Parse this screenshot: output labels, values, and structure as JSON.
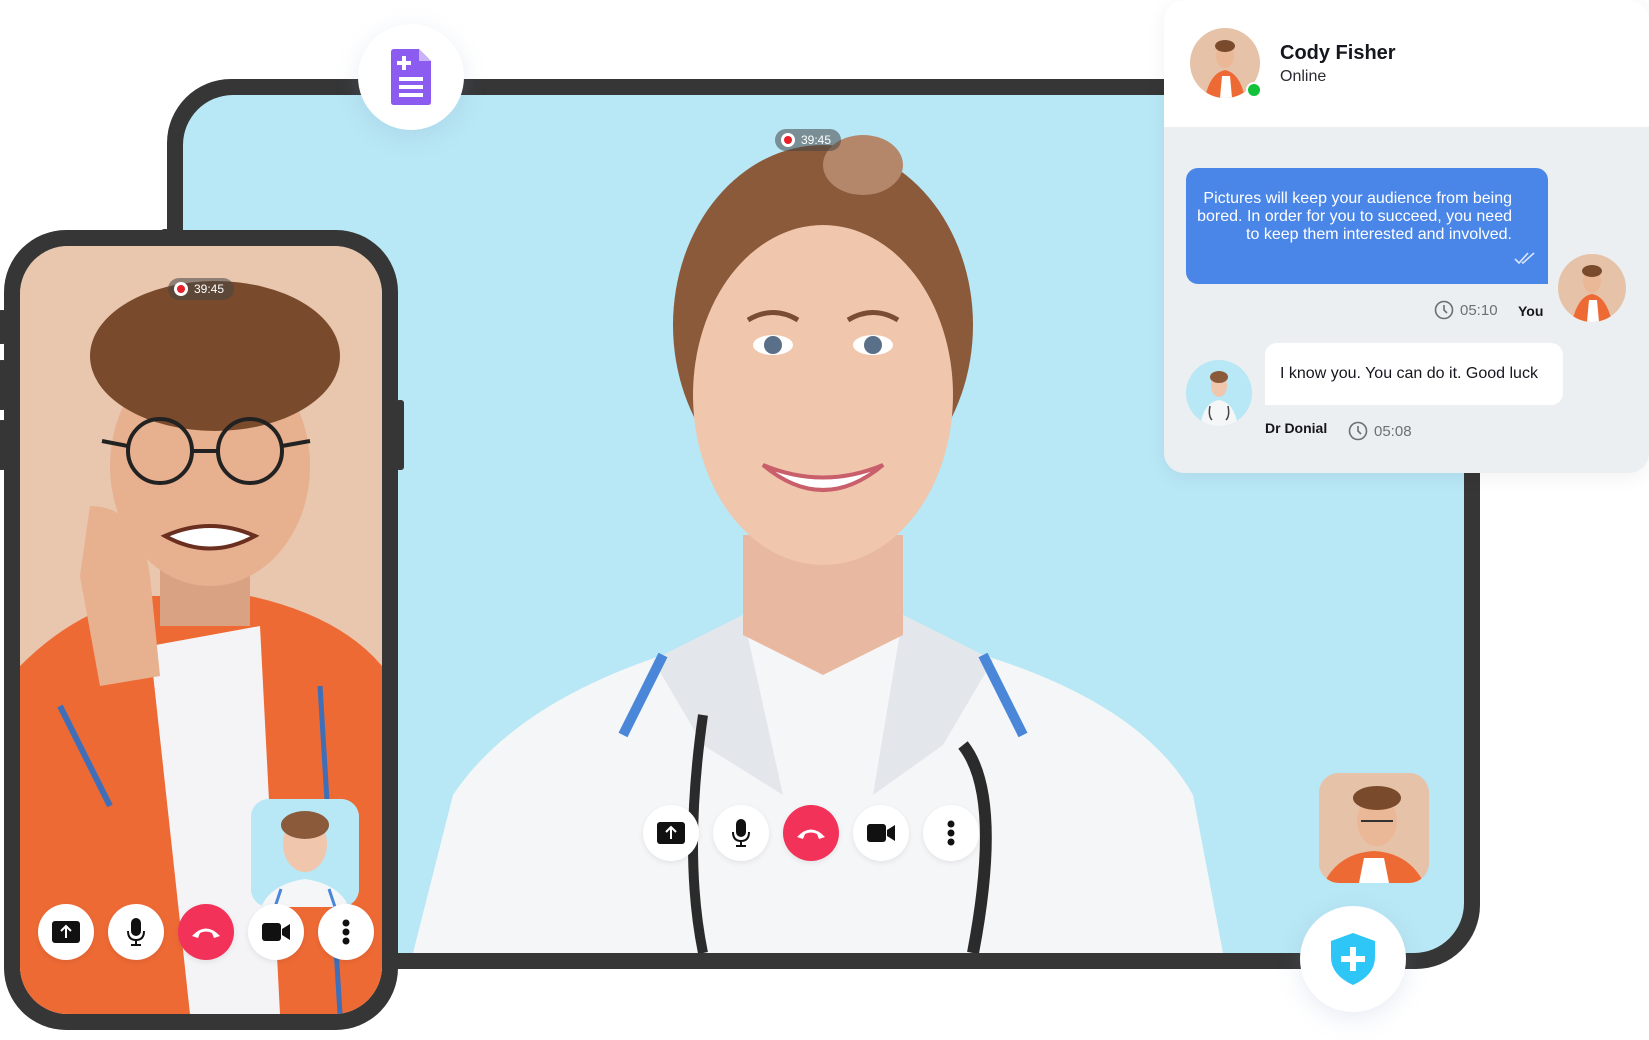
{
  "tablet_call": {
    "recording_time": "39:45",
    "controls": [
      {
        "name": "share-screen",
        "icon": "share-screen-icon"
      },
      {
        "name": "microphone",
        "icon": "microphone-icon"
      },
      {
        "name": "end-call",
        "icon": "end-call-icon"
      },
      {
        "name": "video",
        "icon": "video-camera-icon"
      },
      {
        "name": "more",
        "icon": "more-vertical-icon"
      }
    ]
  },
  "phone_call": {
    "recording_time": "39:45",
    "controls": [
      {
        "name": "share-screen",
        "icon": "share-screen-icon"
      },
      {
        "name": "microphone",
        "icon": "microphone-icon"
      },
      {
        "name": "end-call",
        "icon": "end-call-icon"
      },
      {
        "name": "video",
        "icon": "video-camera-icon"
      },
      {
        "name": "more",
        "icon": "more-vertical-icon"
      }
    ]
  },
  "floating_icons": {
    "document": "medical-document-icon",
    "shield": "medical-shield-icon"
  },
  "chat": {
    "contact_name": "Cody Fisher",
    "contact_status": "Online",
    "messages": [
      {
        "direction": "outgoing",
        "text": "Pictures will keep your audience from being bored. In order for you to succeed, you need to keep them interested and involved.",
        "time": "05:10",
        "author": "You",
        "read": true
      },
      {
        "direction": "incoming",
        "text": "I know you. You can do it. Good luck",
        "time": "05:08",
        "author": "Dr Donial"
      }
    ]
  },
  "colors": {
    "end_call": "#f3325a",
    "outgoing_bubble": "#4a86e8",
    "online": "#12c23a",
    "document_icon": "#8c5cf0",
    "shield_icon": "#2ec6f7",
    "screen_bg": "#b8e7f5",
    "device_frame": "#363636"
  }
}
